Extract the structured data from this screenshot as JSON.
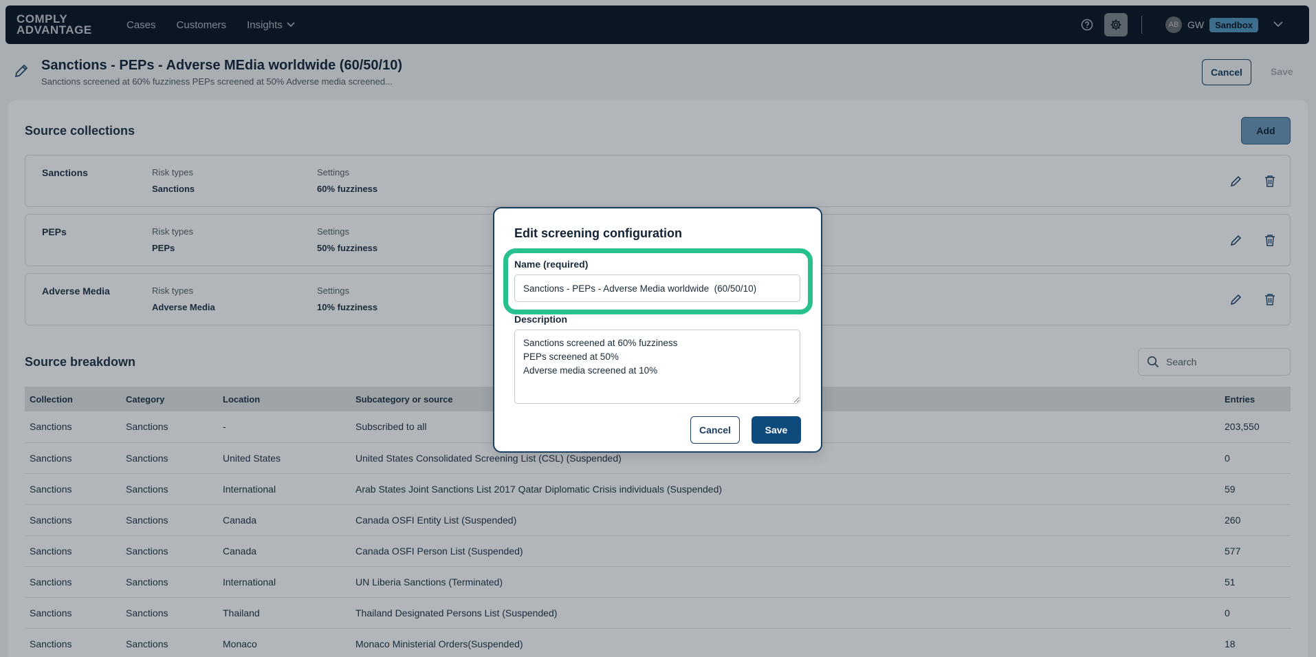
{
  "nav": {
    "logo_line1": "COMPLY",
    "logo_line2": "ADVANTAGE",
    "items": [
      {
        "label": "Cases"
      },
      {
        "label": "Customers"
      },
      {
        "label": "Insights"
      }
    ],
    "avatar_initials": "AB",
    "user_initials": "GW",
    "env_badge": "Sandbox"
  },
  "header": {
    "title": "Sanctions - PEPs - Adverse MEdia worldwide (60/50/10)",
    "subtitle": "Sanctions screened at 60% fuzziness PEPs screened at 50% Adverse media screened...",
    "cancel_label": "Cancel",
    "save_label": "Save"
  },
  "source_collections": {
    "title": "Source collections",
    "add_label": "Add",
    "risk_label": "Risk types",
    "settings_label": "Settings",
    "rows": [
      {
        "name": "Sanctions",
        "risk": "Sanctions",
        "setting": "60% fuzziness"
      },
      {
        "name": "PEPs",
        "risk": "PEPs",
        "setting": "50% fuzziness"
      },
      {
        "name": "Adverse Media",
        "risk": "Adverse Media",
        "setting": "10% fuzziness"
      }
    ]
  },
  "source_breakdown": {
    "title": "Source breakdown",
    "search_placeholder": "Search",
    "columns": [
      "Collection",
      "Category",
      "Location",
      "Subcategory or source",
      "Entries"
    ],
    "rows": [
      [
        "Sanctions",
        "Sanctions",
        "-",
        "Subscribed to all",
        "203,550"
      ],
      [
        "Sanctions",
        "Sanctions",
        "United States",
        "United States Consolidated Screening List (CSL) (Suspended)",
        "0"
      ],
      [
        "Sanctions",
        "Sanctions",
        "International",
        "Arab States Joint Sanctions List 2017 Qatar Diplomatic Crisis individuals (Suspended)",
        "59"
      ],
      [
        "Sanctions",
        "Sanctions",
        "Canada",
        "Canada OSFI Entity List (Suspended)",
        "260"
      ],
      [
        "Sanctions",
        "Sanctions",
        "Canada",
        "Canada OSFI Person List (Suspended)",
        "577"
      ],
      [
        "Sanctions",
        "Sanctions",
        "International",
        "UN Liberia Sanctions (Terminated)",
        "51"
      ],
      [
        "Sanctions",
        "Sanctions",
        "Thailand",
        "Thailand Designated Persons List (Suspended)",
        "0"
      ],
      [
        "Sanctions",
        "Sanctions",
        "Monaco",
        "Monaco Ministerial Orders(Suspended)",
        "18"
      ]
    ]
  },
  "dialog": {
    "title": "Edit screening configuration",
    "name_label": "Name (required)",
    "name_value": "Sanctions - PEPs - Adverse Media worldwide  (60/50/10)",
    "description_label": "Description",
    "description_value": "Sanctions screened at 60% fuzziness\nPEPs screened at 50%\nAdverse media screened at 10%",
    "cancel_label": "Cancel",
    "save_label": "Save"
  }
}
